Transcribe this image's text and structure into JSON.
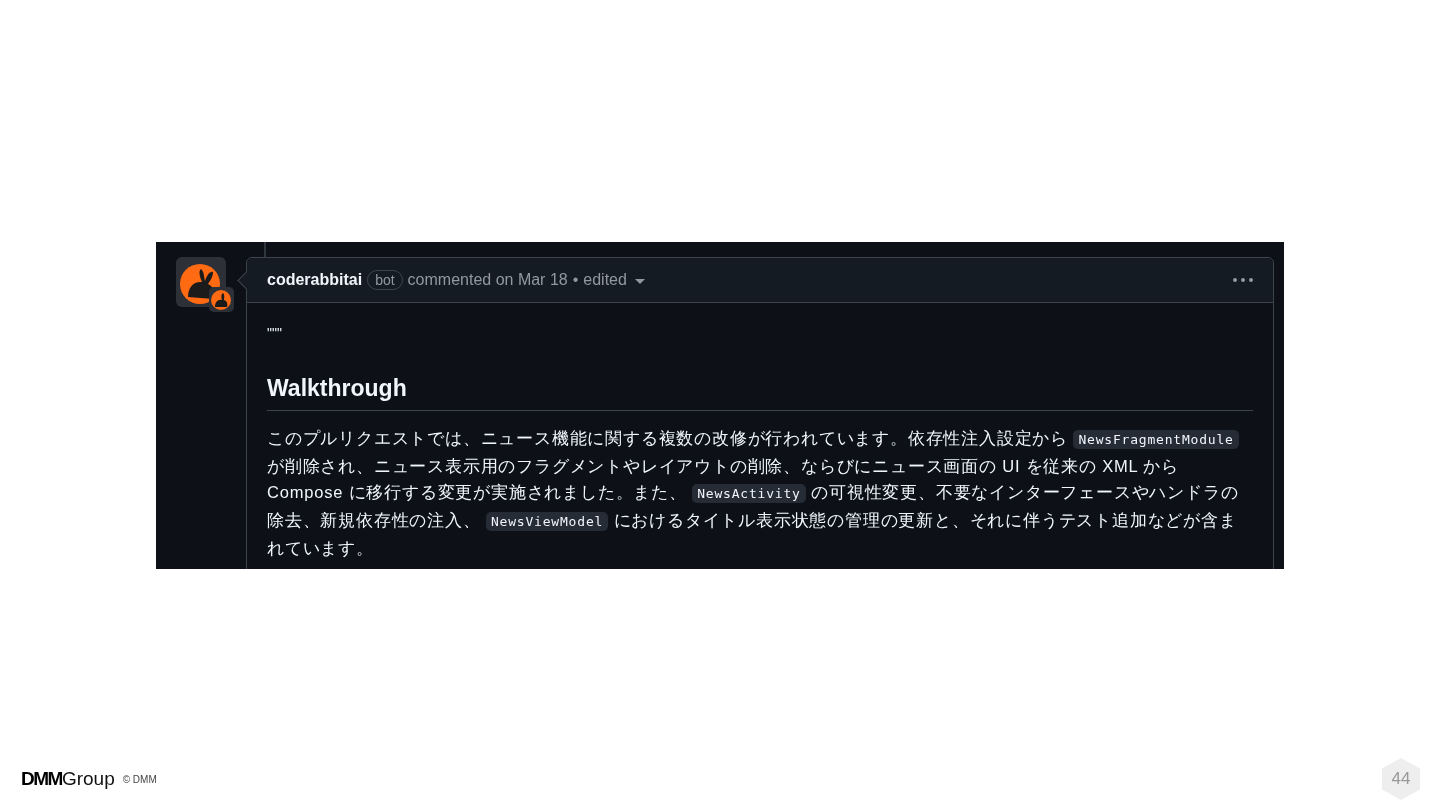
{
  "comment": {
    "author": "coderabbitai",
    "badge": "bot",
    "meta": "commented on Mar 18",
    "separator": "•",
    "edited": "edited",
    "quote": "\"\"\"",
    "heading": "Walkthrough",
    "paragraph": [
      {
        "kind": "text",
        "text": "このプルリクエストでは、ニュース機能に関する複数の改修が行われています。依存性注入設定から "
      },
      {
        "kind": "code",
        "text": "NewsFragmentModule"
      },
      {
        "kind": "text",
        "text": " が削除され、ニュース表示用のフラグメントやレイアウトの削除、ならびにニュース画面の UI を従来の XML から Compose に移行する変更が実施されました。また、 "
      },
      {
        "kind": "code",
        "text": "NewsActivity"
      },
      {
        "kind": "text",
        "text": " の可視性変更、不要なインターフェースやハンドラの除去、新規依存性の注入、 "
      },
      {
        "kind": "code",
        "text": "NewsViewModel"
      },
      {
        "kind": "text",
        "text": " におけるタイトル表示状態の管理の更新と、それに伴うテスト追加などが含まれています。"
      }
    ]
  },
  "footer": {
    "logo_bold": "DMM",
    "logo_light": "Group",
    "copyright": "© DMM",
    "page_number": "44"
  }
}
